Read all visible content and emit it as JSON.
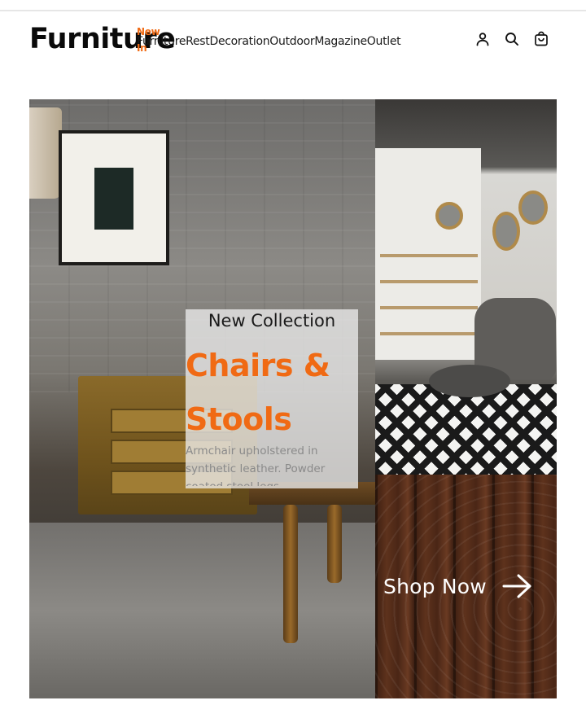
{
  "brand": {
    "logo": "Furniture"
  },
  "nav": {
    "items": [
      {
        "label": "Furniture",
        "badge": "New",
        "badge_line2": "In"
      },
      {
        "label": "Rest"
      },
      {
        "label": "Decoration"
      },
      {
        "label": "Outdoor"
      },
      {
        "label": "Magazine"
      },
      {
        "label": "Outlet"
      }
    ]
  },
  "header_icons": [
    "user-icon",
    "search-icon",
    "cart-icon"
  ],
  "hero": {
    "kicker": "New Collection",
    "title": "Chairs & Stools",
    "description": "Armchair upholstered in synthetic leather. Powder coated steel legs.",
    "cta_label": "Shop Now"
  },
  "colors": {
    "accent": "#f06a14",
    "text": "#1a1a1a",
    "muted": "#8a8a8a"
  }
}
